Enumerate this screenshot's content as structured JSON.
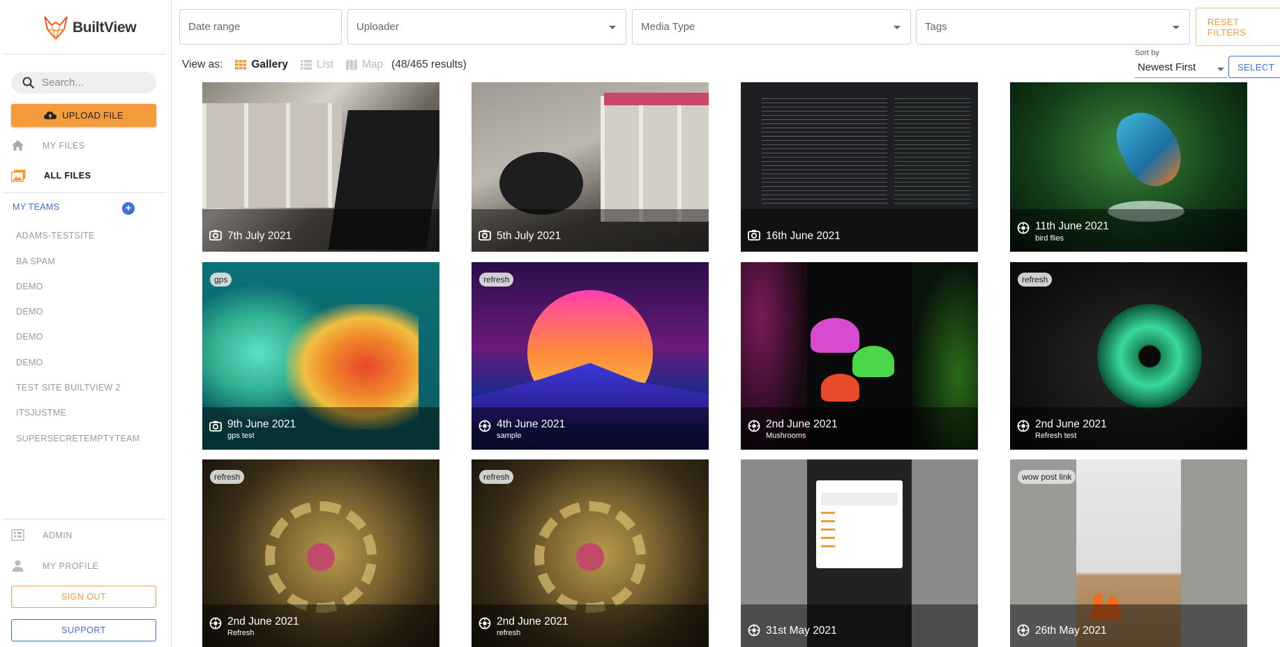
{
  "app": {
    "name": "BuiltView"
  },
  "sidebar": {
    "search_placeholder": "Search...",
    "upload_label": "UPLOAD FILE",
    "nav": [
      {
        "label": "MY FILES",
        "icon": "home-icon"
      },
      {
        "label": "ALL FILES",
        "icon": "images-icon",
        "active": true
      }
    ],
    "teams_header": "MY TEAMS",
    "teams": [
      "ADAMS-TESTSITE",
      "BA SPAM",
      "DEMO",
      "DEMO",
      "DEMO",
      "DEMO",
      "TEST SITE BUILTVIEW 2",
      "ITSJUSTME",
      "SUPERSECRETEMPTYTEAM"
    ],
    "admin_label": "ADMIN",
    "profile_label": "MY PROFILE",
    "signout_label": "SIGN OUT",
    "support_label": "SUPPORT"
  },
  "filters": {
    "date_range": "Date range",
    "uploader": "Uploader",
    "media_type": "Media Type",
    "tags": "Tags",
    "reset_label": "RESET FILTERS"
  },
  "view": {
    "label": "View as:",
    "options": [
      "Gallery",
      "List",
      "Map"
    ],
    "active": "Gallery",
    "results": "(48/465 results)"
  },
  "sort": {
    "label": "Sort by",
    "value": "Newest First"
  },
  "select_label": "SELECT",
  "gallery": [
    {
      "date": "7th July 2021",
      "caption": "",
      "badge": "",
      "icon": "camera-icon"
    },
    {
      "date": "5th July 2021",
      "caption": "",
      "badge": "",
      "icon": "camera-icon"
    },
    {
      "date": "16th June 2021",
      "caption": "",
      "badge": "",
      "icon": "camera-icon"
    },
    {
      "date": "11th June 2021",
      "caption": "bird flies",
      "badge": "",
      "icon": "camera-upload-icon"
    },
    {
      "date": "9th June 2021",
      "caption": "gps test",
      "badge": "gps",
      "icon": "camera-icon"
    },
    {
      "date": "4th June 2021",
      "caption": "sample",
      "badge": "refresh",
      "icon": "camera-upload-icon"
    },
    {
      "date": "2nd June 2021",
      "caption": "Mushrooms",
      "badge": "",
      "icon": "camera-upload-icon"
    },
    {
      "date": "2nd June 2021",
      "caption": "Refresh test",
      "badge": "refresh",
      "icon": "camera-upload-icon"
    },
    {
      "date": "2nd June 2021",
      "caption": "Refresh",
      "badge": "refresh",
      "icon": "camera-upload-icon"
    },
    {
      "date": "2nd June 2021",
      "caption": "refresh",
      "badge": "refresh",
      "icon": "camera-upload-icon"
    },
    {
      "date": "31st May 2021",
      "caption": "",
      "badge": "",
      "icon": "camera-upload-icon"
    },
    {
      "date": "26th May 2021",
      "caption": "",
      "badge": "wow post link",
      "icon": "camera-upload-icon"
    }
  ]
}
